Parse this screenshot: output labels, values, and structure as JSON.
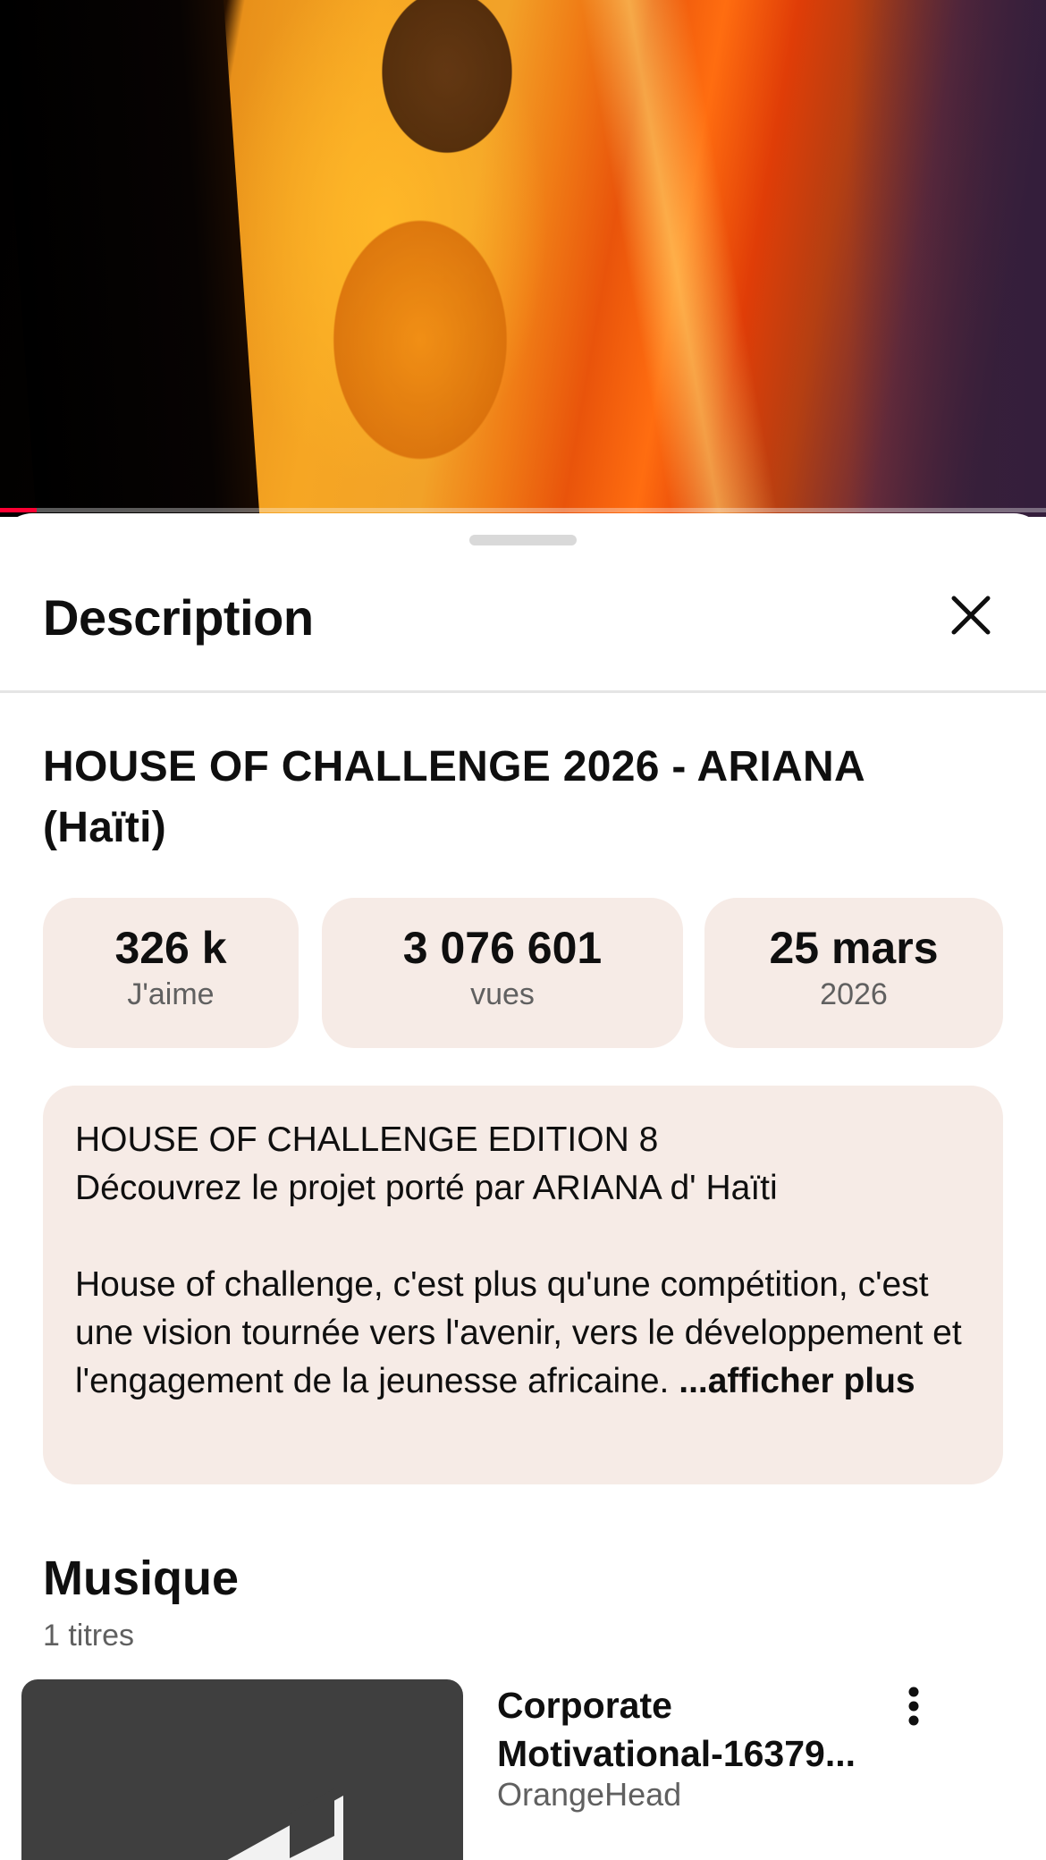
{
  "video": {
    "progress_fraction": 0.035,
    "progress_color": "#ff0033"
  },
  "sheet": {
    "title": "Description",
    "close_icon": "close-icon"
  },
  "video_title": "HOUSE OF CHALLENGE 2026 - ARIANA (Haïti)",
  "stats": {
    "likes_value": "326 k",
    "likes_label": "J'aime",
    "views_value": "3 076 601",
    "views_label": "vues",
    "date_value": "25 mars",
    "date_year": "2026"
  },
  "description": {
    "line1": "HOUSE OF CHALLENGE EDITION 8",
    "line2": "Découvrez le projet porté par ARIANA d' Haïti",
    "paragraph": "House of challenge, c'est plus qu'une compétition, c'est une vision tournée vers l'avenir, vers le développement et l'engagement de la jeunesse africaine.",
    "more_label": "...afficher plus"
  },
  "music": {
    "title": "Musique",
    "count": "1 titres",
    "tracks": [
      {
        "title": "Corporate Motivational-16379...",
        "artist": "OrangeHead",
        "menu_icon": "more-vert-icon"
      }
    ]
  },
  "colors": {
    "card_bg": "#f6ebe6",
    "secondary_text": "#606060"
  }
}
